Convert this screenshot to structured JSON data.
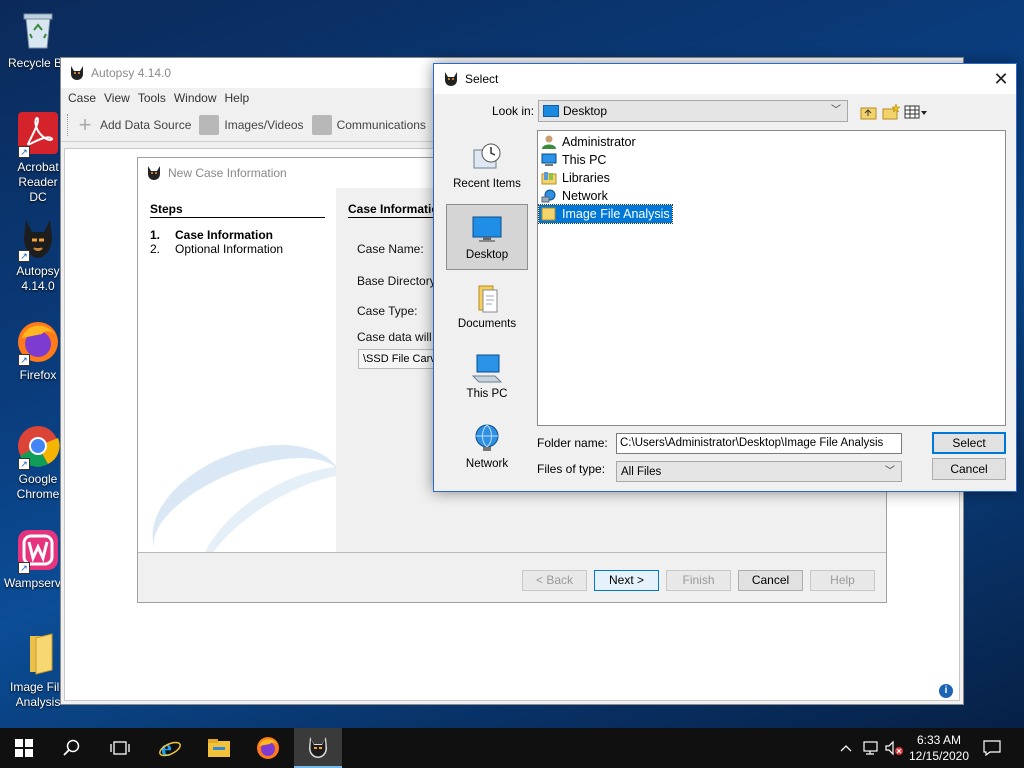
{
  "desktop": {
    "icons": [
      {
        "label": "Recycle Bin"
      },
      {
        "label": "Acrobat Reader DC"
      },
      {
        "label": "Autopsy 4.14.0"
      },
      {
        "label": "Firefox"
      },
      {
        "label": "Google Chrome"
      },
      {
        "label": "Wampserver"
      },
      {
        "label": "Image File Analysis"
      }
    ]
  },
  "autopsy": {
    "title": "Autopsy 4.14.0",
    "menu": [
      "Case",
      "View",
      "Tools",
      "Window",
      "Help"
    ],
    "toolbar": {
      "add_data_source": "Add Data Source",
      "images_videos": "Images/Videos",
      "communications": "Communications"
    }
  },
  "wizard": {
    "title": "New Case Information",
    "steps_header": "Steps",
    "steps": [
      {
        "num": "1.",
        "label": "Case Information",
        "active": true
      },
      {
        "num": "2.",
        "label": "Optional Information",
        "active": false
      }
    ],
    "content_header": "Case Information",
    "case_name_label": "Case Name:",
    "base_directory_label": "Base Directory:",
    "case_type_label": "Case Type:",
    "case_data_label": "Case data will be stored in the following directory:",
    "case_data_path": "\\SSD File Carving",
    "buttons": {
      "back": "< Back",
      "next": "Next >",
      "finish": "Finish",
      "cancel": "Cancel",
      "help": "Help"
    }
  },
  "select_dialog": {
    "title": "Select",
    "look_in_label": "Look in:",
    "look_in_value": "Desktop",
    "places": [
      "Recent Items",
      "Desktop",
      "Documents",
      "This PC",
      "Network"
    ],
    "active_place": "Desktop",
    "files": [
      {
        "name": "Administrator",
        "icon": "user-icon"
      },
      {
        "name": "This PC",
        "icon": "computer-icon"
      },
      {
        "name": "Libraries",
        "icon": "library-icon"
      },
      {
        "name": "Network",
        "icon": "network-icon"
      },
      {
        "name": "Image File Analysis",
        "icon": "folder-icon",
        "selected": true
      }
    ],
    "folder_name_label": "Folder name:",
    "folder_name_value": "C:\\Users\\Administrator\\Desktop\\Image File Analysis",
    "files_of_type_label": "Files of type:",
    "files_of_type_value": "All Files",
    "select_button": "Select",
    "cancel_button": "Cancel"
  },
  "taskbar": {
    "time": "6:33 AM",
    "date": "12/15/2020"
  },
  "colors": {
    "accent": "#0078d7",
    "selection": "#0078d7",
    "taskbar": "#101010"
  }
}
